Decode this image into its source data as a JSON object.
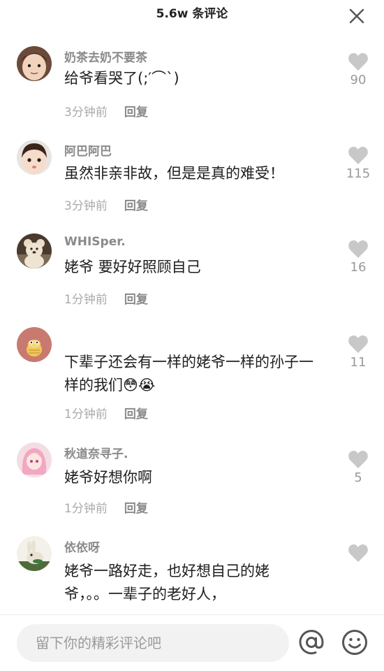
{
  "header": {
    "title": "5.6w 条评论"
  },
  "comments": [
    {
      "username": "奶茶去奶不要茶",
      "text": "给爷看哭了(;′⌒`)",
      "time": "3分钟前",
      "reply": "回复",
      "likes": "90",
      "avatar": "baby-portrait"
    },
    {
      "username": "阿巴阿巴",
      "text": "虽然非亲非故，但是是真的难受！",
      "time": "3分钟前",
      "reply": "回复",
      "likes": "115",
      "avatar": "baby-portrait"
    },
    {
      "username": "WHISper.",
      "text": "姥爷 要好好照顾自己",
      "time": "1分钟前",
      "reply": "回复",
      "likes": "16",
      "avatar": "teddy-bear"
    },
    {
      "username": "",
      "text": "下辈子还会有一样的姥爷一样的孙子一样的我们😳😭",
      "time": "1分钟前",
      "reply": "回复",
      "likes": "11",
      "avatar": "cartoon-cake"
    },
    {
      "username": "秋道奈寻子.",
      "text": "姥爷好想你啊",
      "time": "1分钟前",
      "reply": "回复",
      "likes": "5",
      "avatar": "anime-girl"
    },
    {
      "username": "依依呀",
      "text": "姥爷一路好走，也好想自己的姥爷，。。一辈子的老好人，",
      "time": "",
      "reply": "",
      "likes": "",
      "avatar": "bunny"
    }
  ],
  "input": {
    "placeholder": "留下你的精彩评论吧"
  },
  "icons": {
    "close": "close-icon",
    "like": "heart-icon",
    "mention": "at-icon",
    "emoji": "emoji-icon"
  },
  "colors": {
    "heart": "#c8c8c8",
    "meta_text": "#aaaaaa",
    "username": "#8a8a8a",
    "input_bg": "#f2f2f2"
  }
}
